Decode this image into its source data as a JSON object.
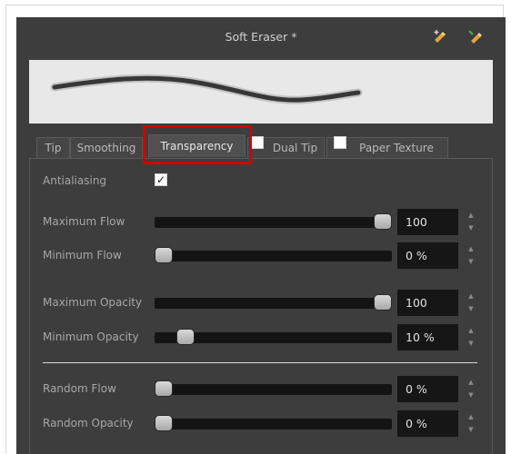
{
  "window": {
    "title": "Soft Eraser *"
  },
  "toolbar_icons": [
    "new-preset-icon",
    "new-brush-icon"
  ],
  "tabs": [
    {
      "label": "Tip"
    },
    {
      "label": "Smoothing"
    },
    {
      "label": "Transparency",
      "active": true
    },
    {
      "label": "Dual Tip",
      "checked": false
    },
    {
      "label": "Paper Texture",
      "checked": false
    }
  ],
  "transparency": {
    "antialiasing": {
      "label": "Antialiasing",
      "checked": true,
      "check_glyph": "✓"
    },
    "maximum_flow": {
      "label": "Maximum Flow",
      "value": "100",
      "fraction": 1.0
    },
    "minimum_flow": {
      "label": "Minimum Flow",
      "value": "0 %",
      "fraction": 0.0
    },
    "maximum_opacity": {
      "label": "Maximum Opacity",
      "value": "100",
      "fraction": 1.0
    },
    "minimum_opacity": {
      "label": "Minimum Opacity",
      "value": "10 %",
      "fraction": 0.1
    },
    "random_flow": {
      "label": "Random Flow",
      "value": "0 %",
      "fraction": 0.0
    },
    "random_opacity": {
      "label": "Random Opacity",
      "value": "0 %",
      "fraction": 0.0
    }
  },
  "spin_glyphs": {
    "up": "▲",
    "down": "▼"
  },
  "colors": {
    "panel_bg": "#3d3d3d",
    "highlight": "#d40000",
    "field_bg": "#161616"
  }
}
